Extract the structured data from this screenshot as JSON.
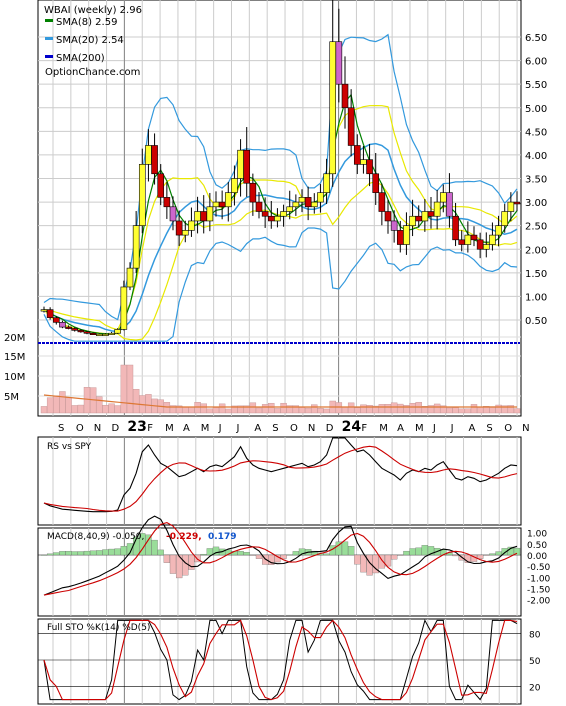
{
  "chart_data": [
    {
      "type": "candlestick",
      "title": "WBAI (weekly) 2.96",
      "watermark": "OptionChance.com",
      "legend": [
        {
          "label": "SMA(8) 2.59",
          "color": "#008000"
        },
        {
          "label": "SMA(20) 2.54",
          "color": "#3399dd"
        },
        {
          "label": "SMA(200)",
          "color": "#0000cc"
        }
      ],
      "y_ticks": [
        "6.50",
        "6.00",
        "5.50",
        "5.00",
        "4.50",
        "4.00",
        "3.50",
        "3.00",
        "2.50",
        "2.00",
        "1.50",
        "1.00",
        "0.50"
      ],
      "ylim": [
        0,
        7
      ],
      "volume_ticks": [
        "20M",
        "15M",
        "10M",
        "5M"
      ],
      "x_month_labels": [
        "S",
        "O",
        "N",
        "D",
        "23",
        "F",
        "M",
        "A",
        "M",
        "J",
        "J",
        "A",
        "S",
        "O",
        "N",
        "D",
        "24",
        "F",
        "M",
        "A",
        "M",
        "J",
        "J",
        "A",
        "S",
        "O",
        "N"
      ],
      "grid": true,
      "colors": {
        "up": "#ffff33",
        "down": "#cc0000",
        "purple": "#cc66cc",
        "bollinger": "#3399dd",
        "yellow_band": "#e8e800",
        "volume": "#f2b8b8",
        "sma200": "#0000cc",
        "orange": "#dd7733"
      },
      "price_path": [
        0.72,
        0.55,
        0.45,
        0.35,
        0.32,
        0.28,
        0.25,
        0.22,
        0.2,
        0.2,
        0.2,
        0.22,
        0.3,
        1.2,
        1.6,
        2.5,
        3.8,
        4.2,
        3.6,
        3.1,
        2.9,
        2.6,
        2.3,
        2.4,
        2.6,
        2.8,
        2.6,
        2.9,
        3.0,
        2.9,
        3.2,
        3.5,
        4.1,
        3.4,
        3.0,
        2.8,
        2.7,
        2.6,
        2.7,
        2.8,
        2.9,
        3.0,
        3.1,
        2.9,
        3.0,
        3.2,
        3.6,
        6.4,
        5.5,
        5.0,
        4.2,
        3.8,
        3.9,
        3.6,
        3.2,
        2.8,
        2.6,
        2.4,
        2.1,
        2.5,
        2.7,
        2.6,
        2.8,
        2.7,
        3.0,
        3.2,
        2.7,
        2.2,
        2.1,
        2.3,
        2.2,
        2.0,
        2.1,
        2.3,
        2.5,
        2.8,
        3.0,
        2.96
      ]
    },
    {
      "type": "line",
      "title": "RS vs SPY",
      "series": [
        {
          "name": "RS",
          "color": "#000000"
        },
        {
          "name": "",
          "color": "#cc0000"
        }
      ]
    },
    {
      "type": "bar",
      "title": "MACD(8,40,9) -0.050, -0.229, 0.179",
      "title_parts": {
        "prefix": "MACD(8,40,9) -0.050,",
        "signal": "-0.229,",
        "hist": "0.179"
      },
      "y_ticks": [
        "1.00",
        "0.50",
        "0.00",
        "-0.50",
        "-1.00",
        "-1.50",
        "-2.00"
      ]
    },
    {
      "type": "line",
      "title": "Full STO %K(14) %D(5)",
      "y_ticks": [
        "80",
        "50",
        "20"
      ]
    }
  ]
}
